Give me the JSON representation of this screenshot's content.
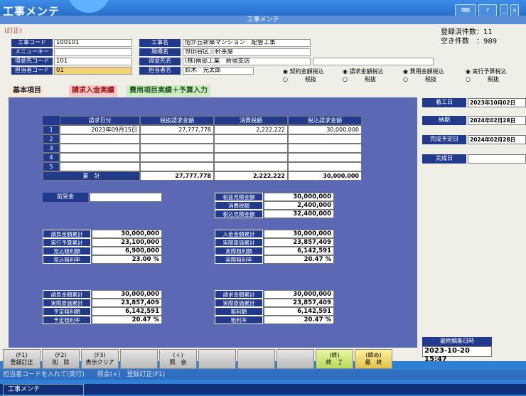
{
  "app": {
    "title": "工事メンテ",
    "window_title": "工事メンテ",
    "mode": "(訂正)"
  },
  "counts": {
    "registered": "登録済件数：11",
    "empty": "空き件数　：989"
  },
  "header": {
    "fields": [
      {
        "label": "工事コード",
        "value": "100101"
      },
      {
        "label": "メニューキー",
        "value": ""
      },
      {
        "label": "得意先コード",
        "value": "101"
      },
      {
        "label": "担当者コード",
        "value": "01"
      }
    ],
    "fields2": [
      {
        "label": "工事名",
        "value": "旭が丘新築マンション　配管工事"
      },
      {
        "label": "現場名",
        "value": "世田谷区三軒茶屋"
      },
      {
        "label": "得意先名",
        "value": "(株)南部工業　新宿支店"
      },
      {
        "label": "担当者名",
        "value": "鈴木　光太郎"
      }
    ]
  },
  "radios": [
    {
      "label": "契約金額税込",
      "sub": "税抜"
    },
    {
      "label": "請求金額税込",
      "sub": "税抜"
    },
    {
      "label": "費用金額税込",
      "sub": "税抜"
    },
    {
      "label": "実行予算税込",
      "sub": "税抜"
    }
  ],
  "tabs": [
    "基本項目",
    "請求入金実績",
    "費用項目実績＋予算入力"
  ],
  "grid": {
    "headers": [
      "請求日付",
      "税抜請求金額",
      "消費税額",
      "税込請求金額"
    ],
    "rows": [
      {
        "no": "1",
        "cells": [
          "2023年09月15日",
          "27,777,778",
          "2,222,222",
          "30,000,000"
        ]
      },
      {
        "no": "2",
        "cells": [
          "",
          "",
          "",
          ""
        ]
      },
      {
        "no": "3",
        "cells": [
          "",
          "",
          "",
          ""
        ]
      },
      {
        "no": "4",
        "cells": [
          "",
          "",
          "",
          ""
        ]
      },
      {
        "no": "5",
        "cells": [
          "",
          "",
          "",
          ""
        ]
      }
    ],
    "total": {
      "label": "累　計",
      "cells": [
        "",
        "27,777,778",
        "2,222,222",
        "30,000,000"
      ]
    }
  },
  "maekin": {
    "label": "前受金",
    "value": ""
  },
  "estimate": [
    {
      "label": "税抜見積金額",
      "value": "30,000,000"
    },
    {
      "label": "消費税額",
      "value": "2,400,000"
    },
    {
      "label": "税込見積金額",
      "value": "32,400,000"
    }
  ],
  "summary_left1": [
    {
      "label": "請負金額累計",
      "value": "30,000,000"
    },
    {
      "label": "実行予算累計",
      "value": "23,100,000"
    },
    {
      "label": "見込粗利額",
      "value": "6,900,000"
    },
    {
      "label": "見込粗利率",
      "value": "23.00 %"
    }
  ],
  "summary_right1": [
    {
      "label": "入金金額累計",
      "value": "30,000,000"
    },
    {
      "label": "実際原価累計",
      "value": "23,857,409"
    },
    {
      "label": "実際粗利額",
      "value": "6,142,591"
    },
    {
      "label": "実際粗利率",
      "value": "20.47 %"
    }
  ],
  "summary_left2": [
    {
      "label": "請負金額累計",
      "value": "30,000,000"
    },
    {
      "label": "実際原価累計",
      "value": "23,857,409"
    },
    {
      "label": "予定粗利額",
      "value": "6,142,591"
    },
    {
      "label": "予定粗利率",
      "value": "20.47 %"
    }
  ],
  "summary_right2": [
    {
      "label": "請求金額累計",
      "value": "30,000,000"
    },
    {
      "label": "実際原価累計",
      "value": "23,857,409"
    },
    {
      "label": "粗利額",
      "value": "6,142,591"
    },
    {
      "label": "粗利率",
      "value": "20.47 %"
    }
  ],
  "dates": [
    {
      "label": "着工日",
      "value": "2023年10月02日"
    },
    {
      "label": "納期",
      "value": "2024年02月28日"
    },
    {
      "label": "完成予定日",
      "value": "2024年02月28日"
    },
    {
      "label": "完成日",
      "value": ""
    }
  ],
  "last_edit": {
    "label": "最終編集日時",
    "value": "2023-10-20 15:47"
  },
  "fkeys": [
    {
      "key": "(F1)",
      "label": "登録訂正"
    },
    {
      "key": "(F2)",
      "label": "削　除"
    },
    {
      "key": "(F3)",
      "label": "表示クリア"
    },
    {
      "key": "",
      "label": ""
    },
    {
      "key": "(＋)",
      "label": "照　会"
    },
    {
      "key": "",
      "label": ""
    },
    {
      "key": "",
      "label": ""
    },
    {
      "key": "",
      "label": ""
    },
    {
      "key": "(終)",
      "label": "終　了"
    },
    {
      "key": "(締め)",
      "label": "最　終"
    }
  ],
  "status": "担当者コードを入れて(実行)　　照会(+)　登録訂正(F1)",
  "taskbar": {
    "item": "工事メンテ"
  },
  "colors": {
    "titlebar": "#1f63c2",
    "label_bg": "#213a8c",
    "panel": "#5b68b3"
  }
}
